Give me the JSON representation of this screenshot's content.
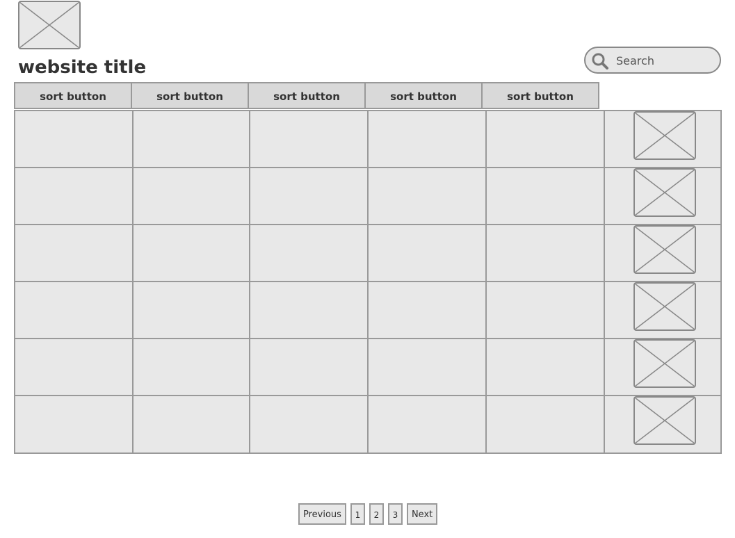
{
  "header": {
    "logo_icon": "image-placeholder-icon",
    "title": "website title",
    "search": {
      "placeholder": "Search",
      "value": "",
      "icon": "search-icon"
    }
  },
  "table": {
    "sort_buttons": [
      {
        "label": "sort button"
      },
      {
        "label": "sort button"
      },
      {
        "label": "sort button"
      },
      {
        "label": "sort button"
      },
      {
        "label": "sort button"
      }
    ],
    "row_count": 6,
    "row_image_icon": "image-placeholder-icon"
  },
  "pagination": {
    "previous_label": "Previous",
    "pages": [
      "1",
      "2",
      "3"
    ],
    "next_label": "Next"
  },
  "colors": {
    "background": "#ffffff",
    "panel_fill": "#e8e8e8",
    "header_fill": "#d9d9d9",
    "border": "#999999",
    "text": "#333333"
  }
}
